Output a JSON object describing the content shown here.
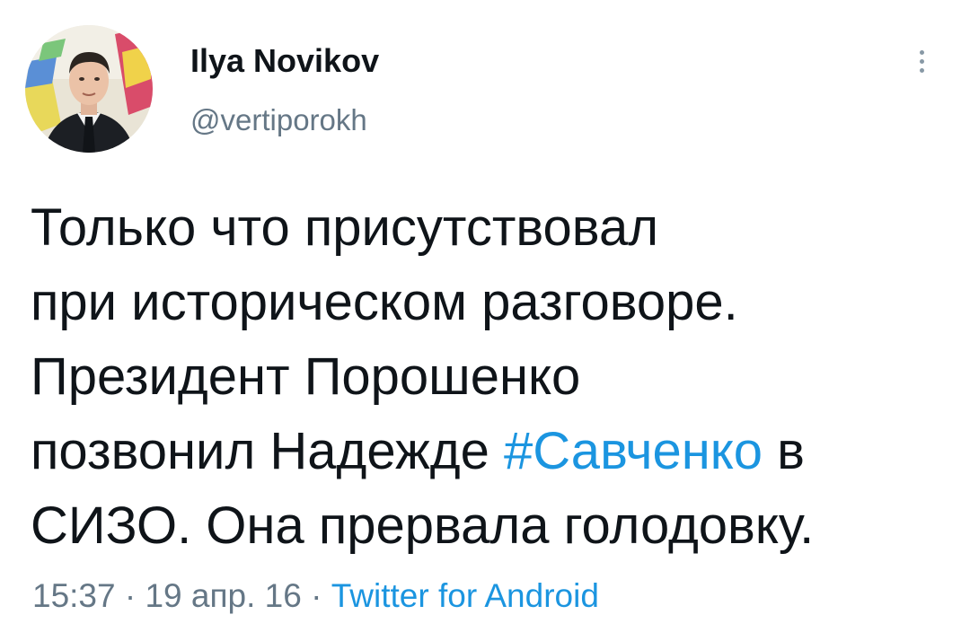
{
  "author": {
    "name": "Ilya Novikov",
    "handle": "@vertiporokh"
  },
  "tweet": {
    "line1": "Только что присутствовал",
    "line2": "при историческом разговоре.",
    "line3": "Президент Порошенко",
    "line4_before": "позвонил Надежде ",
    "hashtag": "#Савченко",
    "line4_after": " в",
    "line5": "СИЗО. Она прервала голодовку."
  },
  "meta": {
    "time": "15:37",
    "sep1": " · ",
    "date": "19 апр. 16",
    "sep2": " · ",
    "source": "Twitter for Android"
  },
  "colors": {
    "link": "#1b95e0",
    "secondary": "#657786",
    "text": "#0f1419"
  },
  "icons": {
    "more": "more-vertical-icon"
  }
}
